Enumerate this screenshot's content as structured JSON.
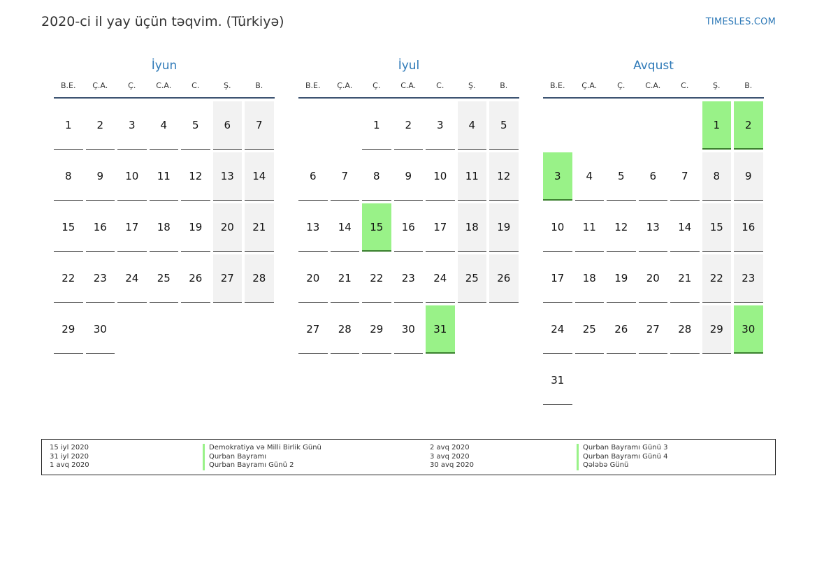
{
  "title": "2020-ci il yay üçün təqvim. (Türkiyə)",
  "brand": "TIMESLES.COM",
  "colors": {
    "accent": "#2f7ab8",
    "holiday": "#99f288",
    "weekend": "#f2f2f2"
  },
  "weekdays": [
    "B.E.",
    "Ç.A.",
    "Ç.",
    "C.A.",
    "C.",
    "Ş.",
    "B."
  ],
  "months": [
    {
      "name": "İyun",
      "offset": 0,
      "days": 30,
      "holidays": []
    },
    {
      "name": "İyul",
      "offset": 2,
      "days": 31,
      "holidays": [
        15,
        31
      ]
    },
    {
      "name": "Avqust",
      "offset": 5,
      "days": 31,
      "holidays": [
        1,
        2,
        3,
        30
      ]
    }
  ],
  "legend": {
    "col1_dates": [
      "15 iyl 2020",
      "31 iyl 2020",
      "1 avq 2020"
    ],
    "col1_names": [
      "Demokratiya və Milli Birlik Günü",
      "Qurban Bayramı",
      "Qurban Bayramı Günü 2"
    ],
    "col2_dates": [
      "2 avq 2020",
      "3 avq 2020",
      "30 avq 2020"
    ],
    "col2_names": [
      "Qurban Bayramı Günü 3",
      "Qurban Bayramı Günü 4",
      "Qələbə Günü"
    ]
  }
}
